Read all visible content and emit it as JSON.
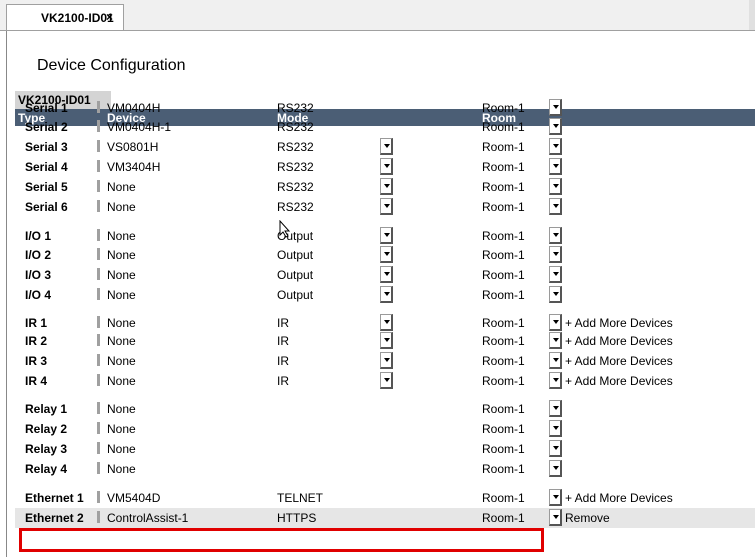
{
  "tab": {
    "title": "VK2100-ID01",
    "close_glyph": "×"
  },
  "page_title": "Device Configuration",
  "device_tab": "VK2100-ID01",
  "headers": {
    "type": "Type",
    "device": "Device",
    "mode": "Mode",
    "room": "Room"
  },
  "rows": [
    {
      "type": "Serial 1",
      "device": "VM0404H",
      "mode": "RS232",
      "room": "Room-1",
      "mode_dropdown": false,
      "action": ""
    },
    {
      "type": "Serial 2",
      "device": "VM0404H-1",
      "mode": "RS232",
      "room": "Room-1",
      "mode_dropdown": false,
      "action": ""
    },
    {
      "type": "Serial 3",
      "device": "VS0801H",
      "mode": "RS232",
      "room": "Room-1",
      "mode_dropdown": true,
      "action": ""
    },
    {
      "type": "Serial 4",
      "device": "VM3404H",
      "mode": "RS232",
      "room": "Room-1",
      "mode_dropdown": true,
      "action": ""
    },
    {
      "type": "Serial 5",
      "device": "None",
      "mode": "RS232",
      "room": "Room-1",
      "mode_dropdown": true,
      "action": ""
    },
    {
      "type": "Serial 6",
      "device": "None",
      "mode": "RS232",
      "room": "Room-1",
      "mode_dropdown": true,
      "action": ""
    },
    {
      "type": "I/O 1",
      "device": "None",
      "mode": "Output",
      "room": "Room-1",
      "mode_dropdown": true,
      "action": ""
    },
    {
      "type": "I/O 2",
      "device": "None",
      "mode": "Output",
      "room": "Room-1",
      "mode_dropdown": true,
      "action": ""
    },
    {
      "type": "I/O 3",
      "device": "None",
      "mode": "Output",
      "room": "Room-1",
      "mode_dropdown": true,
      "action": ""
    },
    {
      "type": "I/O 4",
      "device": "None",
      "mode": "Output",
      "room": "Room-1",
      "mode_dropdown": true,
      "action": ""
    },
    {
      "type": "IR 1",
      "device": "None",
      "mode": "IR",
      "room": "Room-1",
      "mode_dropdown": true,
      "action": "+ Add More Devices"
    },
    {
      "type": "IR 2",
      "device": "None",
      "mode": "IR",
      "room": "Room-1",
      "mode_dropdown": true,
      "action": "+ Add More Devices"
    },
    {
      "type": "IR 3",
      "device": "None",
      "mode": "IR",
      "room": "Room-1",
      "mode_dropdown": true,
      "action": "+ Add More Devices"
    },
    {
      "type": "IR 4",
      "device": "None",
      "mode": "IR",
      "room": "Room-1",
      "mode_dropdown": true,
      "action": "+ Add More Devices"
    },
    {
      "type": "Relay 1",
      "device": "None",
      "mode": "",
      "room": "Room-1",
      "mode_dropdown": false,
      "action": ""
    },
    {
      "type": "Relay 2",
      "device": "None",
      "mode": "",
      "room": "Room-1",
      "mode_dropdown": false,
      "action": ""
    },
    {
      "type": "Relay 3",
      "device": "None",
      "mode": "",
      "room": "Room-1",
      "mode_dropdown": false,
      "action": ""
    },
    {
      "type": "Relay 4",
      "device": "None",
      "mode": "",
      "room": "Room-1",
      "mode_dropdown": false,
      "action": ""
    },
    {
      "type": "Ethernet 1",
      "device": "VM5404D",
      "mode": "TELNET",
      "room": "Room-1",
      "mode_dropdown": false,
      "action": "+ Add More Devices"
    },
    {
      "type": "Ethernet 2",
      "device": "ControlAssist-1",
      "mode": "HTTPS",
      "room": "Room-1",
      "mode_dropdown": false,
      "action": "Remove"
    }
  ],
  "colors": {
    "header_bg": "#4b5e75",
    "highlight_border": "#e00000"
  }
}
